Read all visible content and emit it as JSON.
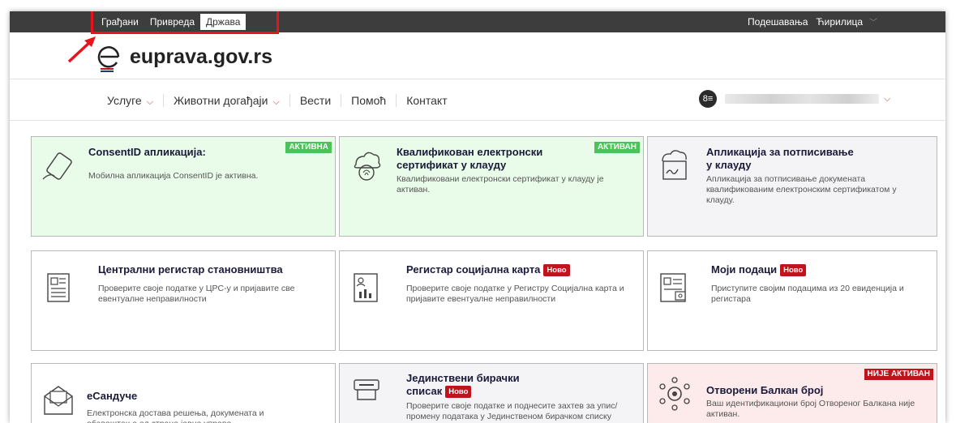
{
  "topnav": {
    "items": [
      "Грађани",
      "Привреда",
      "Држава"
    ],
    "active": "Држава",
    "settings": "Подешавања",
    "script": "Ћирилица"
  },
  "logo": {
    "text": "euprava.gov.rs"
  },
  "menu": {
    "items": [
      {
        "label": "Услуге",
        "has_dropdown": true
      },
      {
        "label": "Животни догађаји",
        "has_dropdown": true
      },
      {
        "label": "Вести",
        "has_dropdown": false
      },
      {
        "label": "Помоћ",
        "has_dropdown": false
      },
      {
        "label": "Контакт",
        "has_dropdown": false
      }
    ],
    "user_avatar": "user-icon"
  },
  "cards": [
    {
      "title": "ConsentID апликација:",
      "desc": "Мобилна апликација ConsentID је активна.",
      "status": "АКТИВНА",
      "icon": "phone-icon",
      "bg": "green"
    },
    {
      "title": "Квалификован електронски сертификат у клауду",
      "desc": "Квалификовани електронски сертификат у клауду је активан.",
      "status": "АКТИВАН",
      "icon": "cloud-fingerprint-icon",
      "bg": "green"
    },
    {
      "title": "Апликација за потписивање у клауду",
      "desc": "Апликација за потписивање докумената квалификованим електронским сертификатом у клауду.",
      "status": "",
      "icon": "cloud-sign-icon",
      "bg": "grey"
    },
    {
      "title": "Централни регистар становништва",
      "desc": "Проверите своје податке у ЦРС-у и пријавите све евентуалне неправилности",
      "badge": "",
      "icon": "register-icon",
      "bg": "white"
    },
    {
      "title": "Регистар социјална карта",
      "desc": "Проверите своје податке у Регистру Социјална карта и пријавите евентуалне неправилности",
      "badge": "Ново",
      "icon": "social-card-icon",
      "bg": "white"
    },
    {
      "title": "Моји подаци",
      "desc": "Приступите својим подацима из 20 евиденција и регистара",
      "badge": "Ново",
      "icon": "my-data-icon",
      "bg": "white"
    },
    {
      "title": "еСандуче",
      "desc": "Електронска достава решења, докумената и обавештења од стране јавне управе",
      "badge": "",
      "icon": "mailbox-icon",
      "bg": "white"
    },
    {
      "title": "Јединствени бирачки списак",
      "desc": "Проверите своје податке и поднесите захтев за упис/промену података у Јединственом бирачком списку",
      "badge": "Ново",
      "icon": "voter-list-icon",
      "bg": "grey"
    },
    {
      "title": "Отворени Балкан број",
      "desc": "Ваш идентификациони број Отвореног Балкана није активан.",
      "status": "НИЈЕ АКТИВАН",
      "icon": "open-balkan-icon",
      "bg": "pink"
    }
  ],
  "colors": {
    "topbar": "#3d3d3d",
    "accent": "#c0141c",
    "active_green": "#4cc35a",
    "highlight": "#e8141b"
  }
}
